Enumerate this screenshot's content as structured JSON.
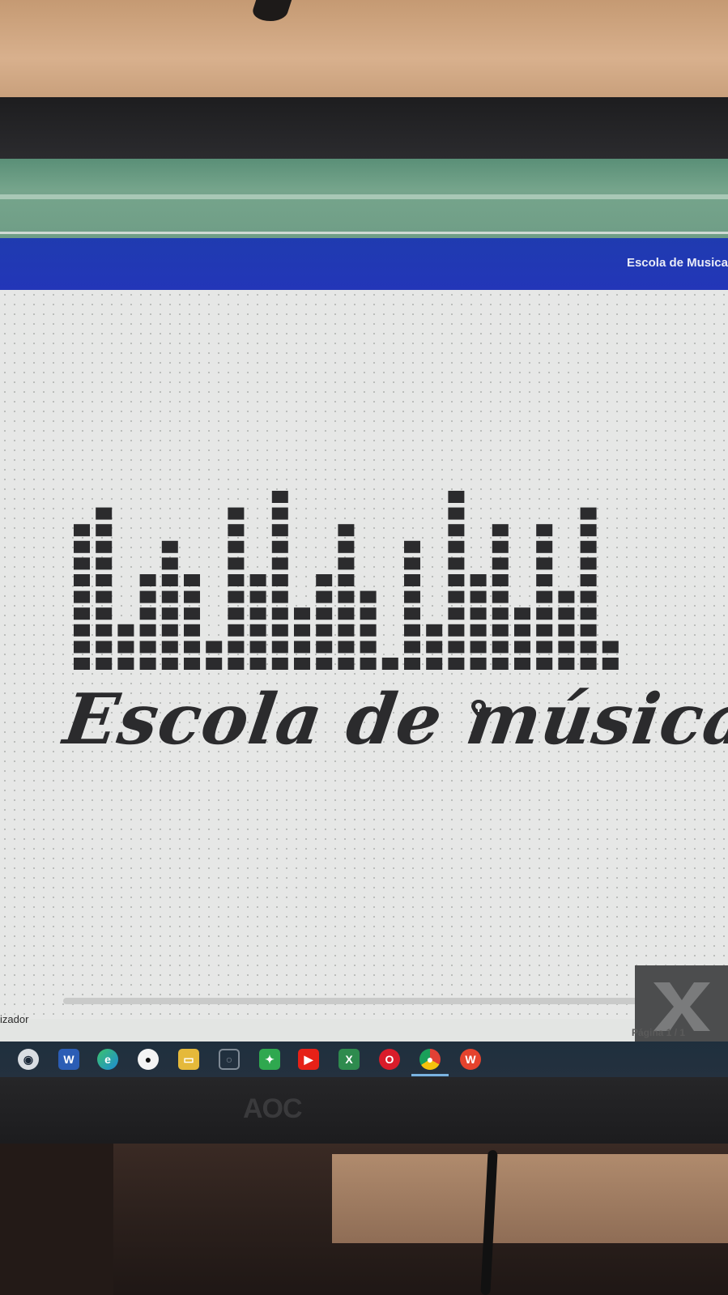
{
  "app": {
    "header_title": "Escola de Musica"
  },
  "design": {
    "logo_text": "Escola de música",
    "equalizer_bars": [
      9,
      10,
      3,
      6,
      8,
      6,
      2,
      10,
      6,
      11,
      4,
      6,
      9,
      5,
      1,
      8,
      3,
      11,
      6,
      9,
      4,
      9,
      5,
      10,
      2
    ]
  },
  "status": {
    "left_label": "izador",
    "page_indicator": "Página 1 / 1"
  },
  "taskbar": {
    "icons": [
      "steam-icon",
      "word-icon",
      "edge-icon",
      "github-icon",
      "file-explorer-icon",
      "instagram-icon",
      "xbox-app-icon",
      "youtube-icon",
      "excel-icon",
      "opera-icon",
      "chrome-icon",
      "wps-office-icon"
    ]
  },
  "monitor": {
    "brand": "AOC"
  },
  "colors": {
    "header_blue": "#2336b8",
    "ink": "#2b2b2d",
    "green_band": "#6f9d86"
  }
}
